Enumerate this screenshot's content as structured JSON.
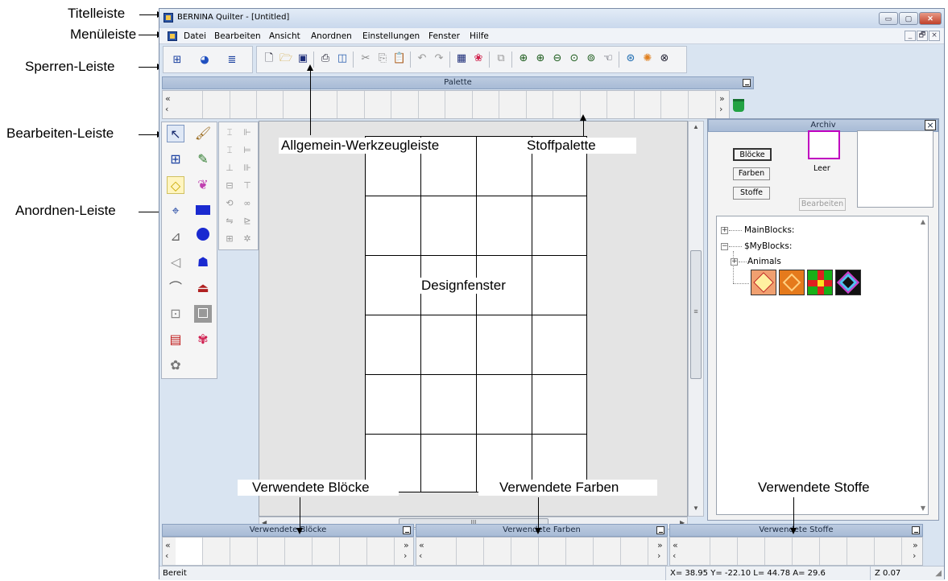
{
  "window": {
    "title": "BERNINA Quilter - [Untitled]",
    "caption_buttons": [
      "▭",
      "▢",
      "✕"
    ],
    "mdi_buttons": [
      "_",
      "🗗",
      "×"
    ]
  },
  "menu": [
    "Datei",
    "Bearbeiten",
    "Ansicht",
    "Anordnen",
    "Einstellungen",
    "Fenster",
    "Hilfe"
  ],
  "annotations": {
    "titelleiste": "Titelleiste",
    "menueleiste": "Menüleiste",
    "sperren_leiste": "Sperren-Leiste",
    "bearbeiten_leiste": "Bearbeiten-Leiste",
    "anordnen_leiste": "Anordnen-Leiste",
    "allgemein": "Allgemein-Werkzeugleiste",
    "stoffpalette": "Stoffpalette",
    "designfenster": "Designfenster",
    "verwendete_bloecke": "Verwendete Blöcke",
    "verwendete_farben": "Verwendete Farben",
    "verwendete_stoffe": "Verwendete Stoffe"
  },
  "palette": {
    "title": "Palette",
    "left_chevrons": [
      "«",
      "‹"
    ],
    "right_chevrons": [
      "»",
      "›"
    ]
  },
  "archiv": {
    "title": "Archiv",
    "close": "×",
    "buttons": {
      "bloecke": "Blöcke",
      "farben": "Farben",
      "stoffe": "Stoffe",
      "bearbeiten": "Bearbeiten"
    },
    "preview_label": "Leer",
    "tree": {
      "main_blocks": "MainBlocks:",
      "my_blocks": "$MyBlocks:",
      "animals": "Animals",
      "expand": "+",
      "collapse": "−"
    }
  },
  "bottom_docks": {
    "bloecke": "Verwendete Blöcke",
    "farben": "Verwendete Farben",
    "stoffe": "Verwendete Stoffe"
  },
  "status": {
    "ready": "Bereit",
    "coords": "X=  38.95 Y= -22.10 L=  44.78 A=  29.6",
    "zoom": "Z 0.07"
  },
  "scroll": {
    "thumb_grip": "III",
    "thumb_grip_v": "≡"
  },
  "colors": {
    "window_bg": "#d9e4f1",
    "design_bg": "#e4e4e4",
    "preview_border": "#c000c0"
  }
}
